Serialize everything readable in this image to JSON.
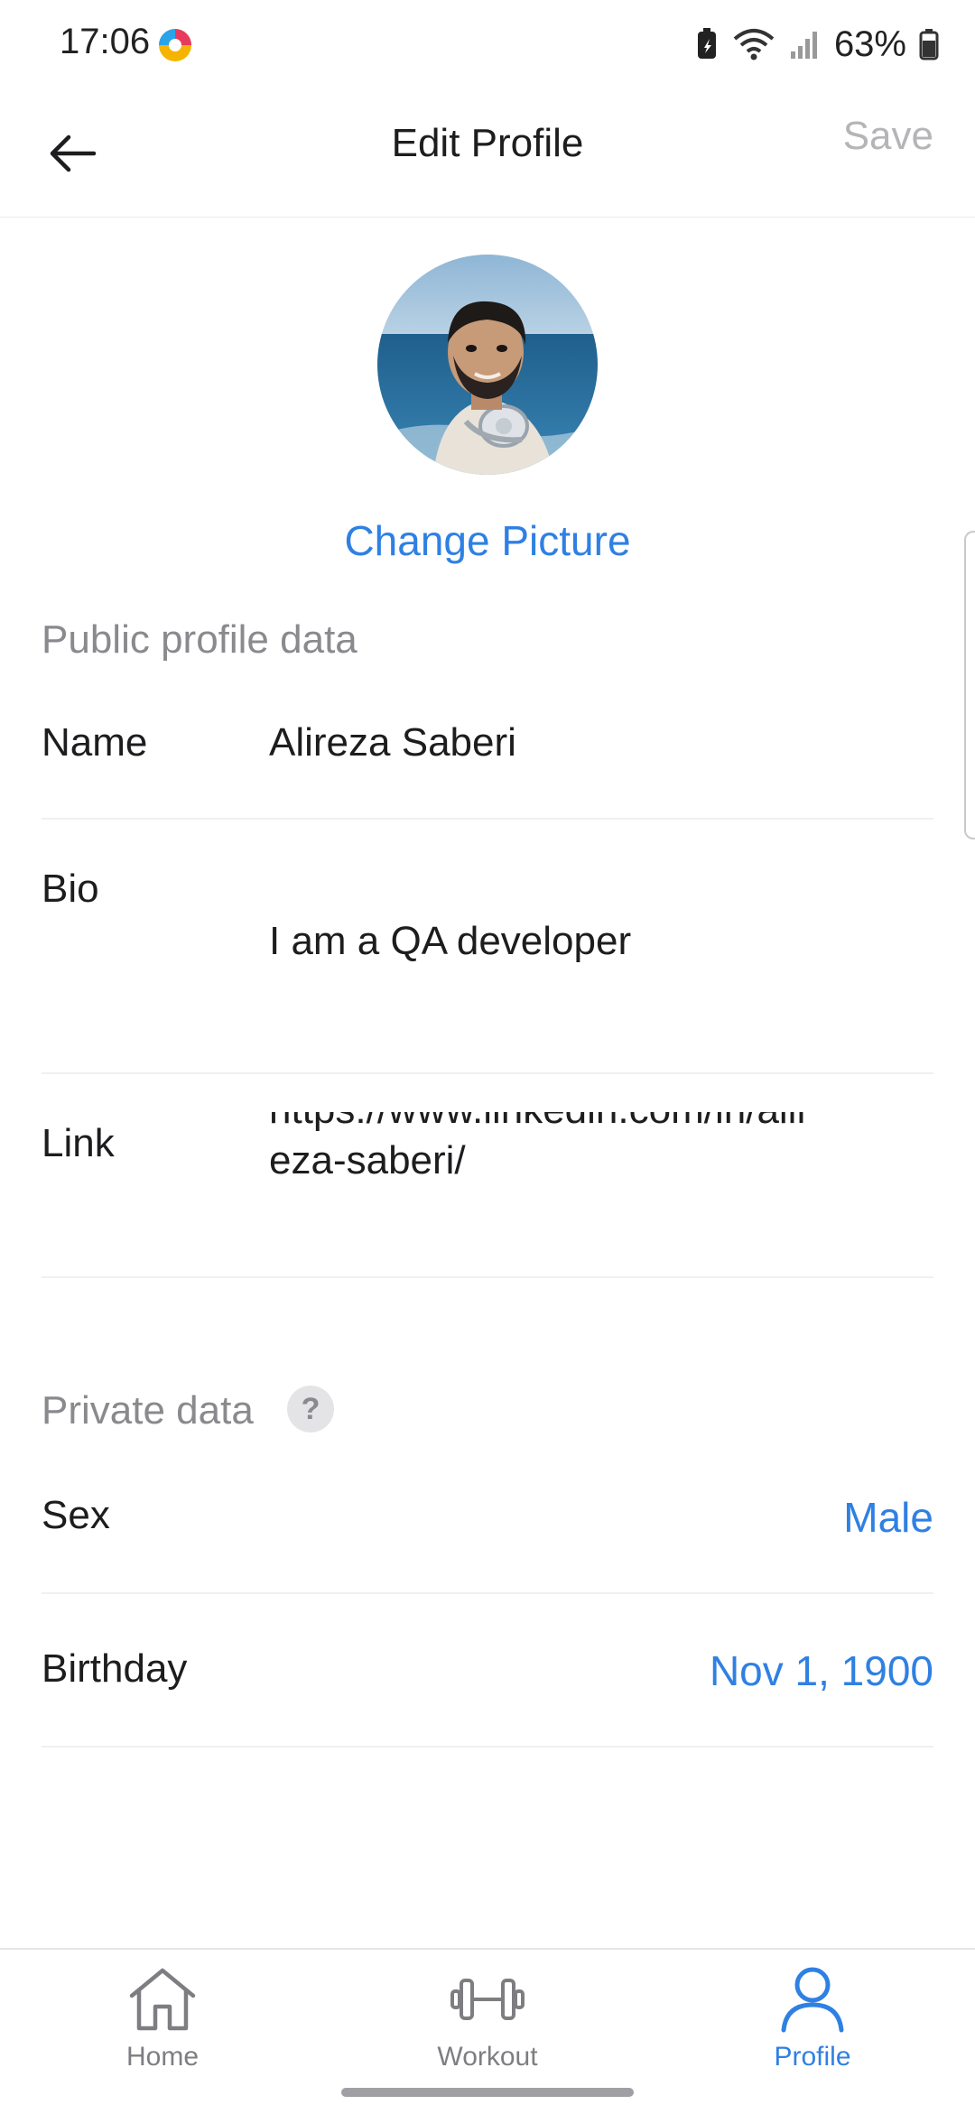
{
  "status_bar": {
    "time": "17:06",
    "battery": "63%"
  },
  "header": {
    "title": "Edit Profile",
    "save_label": "Save"
  },
  "profile": {
    "change_picture_label": "Change Picture"
  },
  "public_section": {
    "title": "Public profile data",
    "name_label": "Name",
    "name_value": "Alireza Saberi",
    "bio_label": "Bio",
    "bio_value": "I am a QA developer",
    "link_label": "Link",
    "link_value": "https://www.linkedin.com/in/alireza-saberi/"
  },
  "private_section": {
    "title": "Private data",
    "help_glyph": "?",
    "sex_label": "Sex",
    "sex_value": "Male",
    "birthday_label": "Birthday",
    "birthday_value": "Nov 1, 1900"
  },
  "bottom_nav": {
    "items": [
      {
        "label": "Home",
        "icon": "home-icon",
        "active": false
      },
      {
        "label": "Workout",
        "icon": "dumbbell-icon",
        "active": false
      },
      {
        "label": "Profile",
        "icon": "person-icon",
        "active": true
      }
    ]
  },
  "colors": {
    "accent": "#2f80e3",
    "muted": "#8a8a8e",
    "save_disabled": "#b5b5b8"
  }
}
